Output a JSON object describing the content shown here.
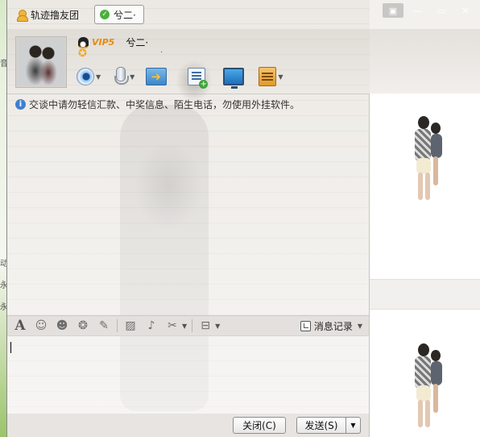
{
  "tabs": [
    {
      "label": "轨迹撸友团"
    },
    {
      "label": "兮二·"
    }
  ],
  "window_controls": [
    "menu",
    "minimize",
    "maximize",
    "close"
  ],
  "contact": {
    "vip_level": "VIP5",
    "name": "兮二·",
    "signature": "·"
  },
  "toolbar": {
    "items": [
      "video-call",
      "voice-call",
      "send-file",
      "create-discussion",
      "remote-assist",
      "apps"
    ]
  },
  "notice": {
    "text": "交谈中请勿轻信汇款、中奖信息、陌生电话，勿使用外挂软件。"
  },
  "input_toolbar": {
    "items": [
      "font",
      "emoji",
      "magic-face",
      "shake",
      "handwriting",
      "image",
      "music",
      "screenshot",
      "more"
    ],
    "history_label": "消息记录"
  },
  "buttons": {
    "close_label": "关闭(C)",
    "send_label": "发送(S)"
  },
  "left_edge_chars": [
    "音",
    "动",
    "永",
    "永"
  ],
  "colors": {
    "accent_green": "#6aa83a",
    "vip_orange": "#e88a0a",
    "info_blue": "#3f7fd0"
  }
}
